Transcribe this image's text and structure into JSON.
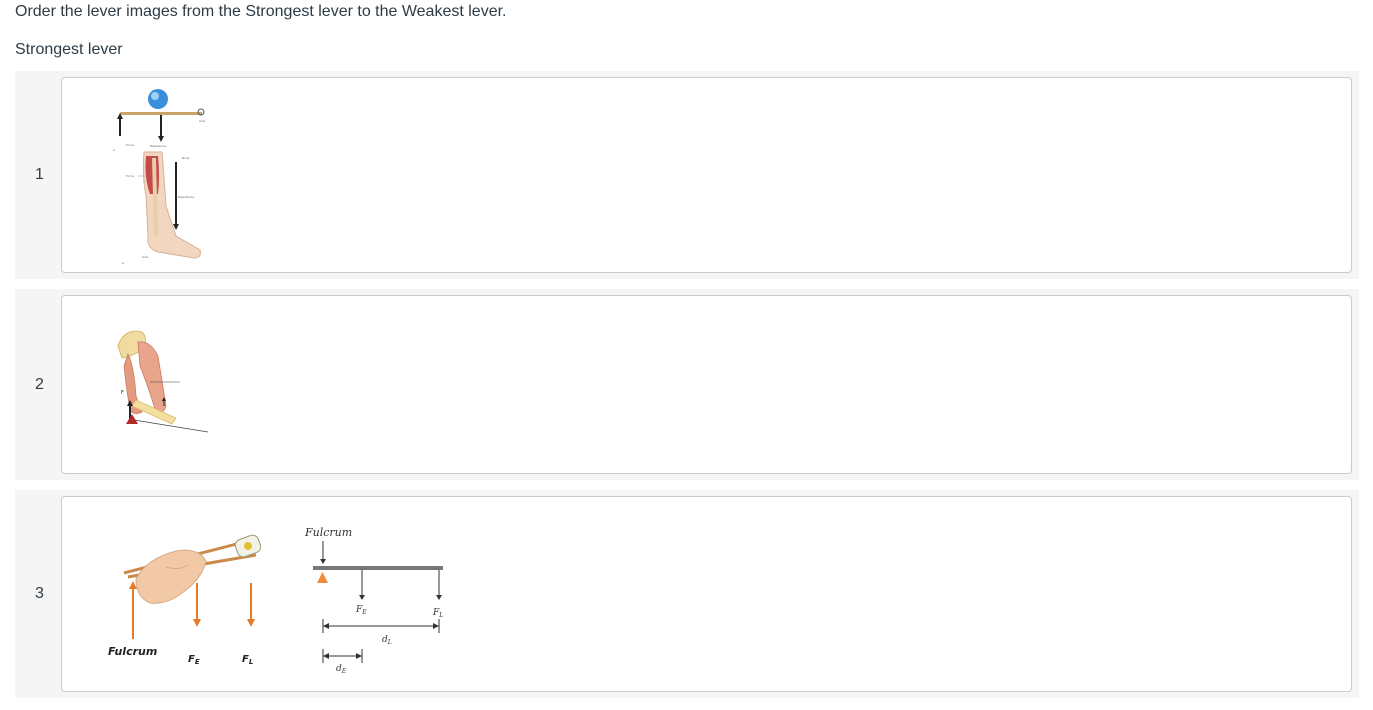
{
  "question": {
    "prompt": "Order the lever images from the Strongest lever to the Weakest lever.",
    "list_label": "Strongest lever"
  },
  "items": [
    {
      "number": "1",
      "image": {
        "description_icon": "foot-lever-icon",
        "labels": {
          "force": "Force",
          "resistance": "Resistance",
          "axis": "Axis",
          "body": "Body",
          "a": "A"
        }
      }
    },
    {
      "number": "2",
      "image": {
        "description_icon": "arm-lever-icon",
        "labels": {
          "f": "F"
        }
      }
    },
    {
      "number": "3",
      "image": {
        "description_icon": "chopsticks-lever-icon",
        "labels": {
          "fulcrum_photo": "Fulcrum",
          "fe_photo": "F",
          "fe_photo_sub": "E",
          "fl_photo": "F",
          "fl_photo_sub": "L",
          "fulcrum_diagram": "Fulcrum",
          "fe_diagram": "F",
          "fe_diagram_sub": "E",
          "fl_diagram": "F",
          "fl_diagram_sub": "L",
          "dl": "d",
          "dl_sub": "L",
          "de": "d",
          "de_sub": "E"
        }
      }
    }
  ],
  "colors": {
    "row_bg": "#f5f5f5",
    "card_border": "#c7cdd1",
    "text": "#2d3b45",
    "arrow_orange": "#e8792b",
    "fulcrum_orange": "#f08a3c"
  }
}
